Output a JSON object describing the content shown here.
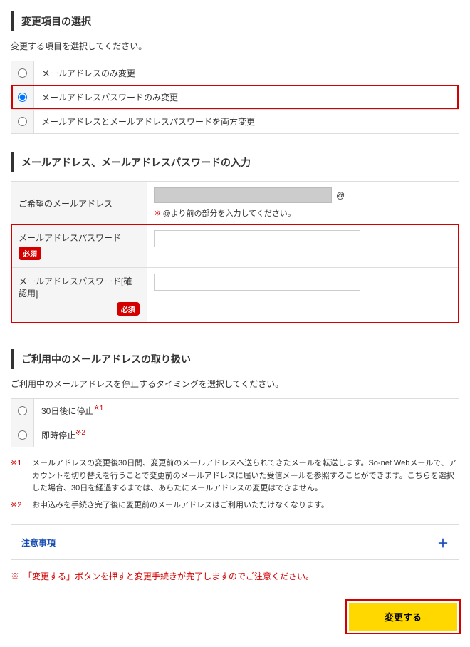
{
  "section1": {
    "title": "変更項目の選択",
    "desc": "変更する項目を選択してください。",
    "options": [
      {
        "label": "メールアドレスのみ変更"
      },
      {
        "label": "メールアドレスパスワードのみ変更"
      },
      {
        "label": "メールアドレスとメールアドレスパスワードを両方変更"
      }
    ]
  },
  "section2": {
    "title": "メールアドレス、メールアドレスパスワードの入力",
    "row1": {
      "label": "ご希望のメールアドレス",
      "at": "@",
      "note_mark": "※",
      "note_text": "@より前の部分を入力してください。"
    },
    "row2": {
      "label": "メールアドレスパスワード",
      "req": "必須"
    },
    "row3": {
      "label": "メールアドレスパスワード[確認用]",
      "req": "必須"
    }
  },
  "section3": {
    "title": "ご利用中のメールアドレスの取り扱い",
    "desc": "ご利用中のメールアドレスを停止するタイミングを選択してください。",
    "options": [
      {
        "label": "30日後に停止",
        "sup": "※1"
      },
      {
        "label": "即時停止",
        "sup": "※2"
      }
    ],
    "foot1_mark": "※1",
    "foot1_text": "メールアドレスの変更後30日間、変更前のメールアドレスへ送られてきたメールを転送します。So-net Webメールで、アカウントを切り替えを行うことで変更前のメールアドレスに届いた受信メールを参照することができます。こちらを選択した場合、30日を経過するまでは、あらたにメールアドレスの変更はできません。",
    "foot2_mark": "※2",
    "foot2_text": "お申込みを手続き完了後に変更前のメールアドレスはご利用いただけなくなります。"
  },
  "accordion": {
    "title": "注意事項",
    "plus": "＋"
  },
  "warning": "※　「変更する」ボタンを押すと変更手続きが完了しますのでご注意ください。",
  "submit": "変更する"
}
